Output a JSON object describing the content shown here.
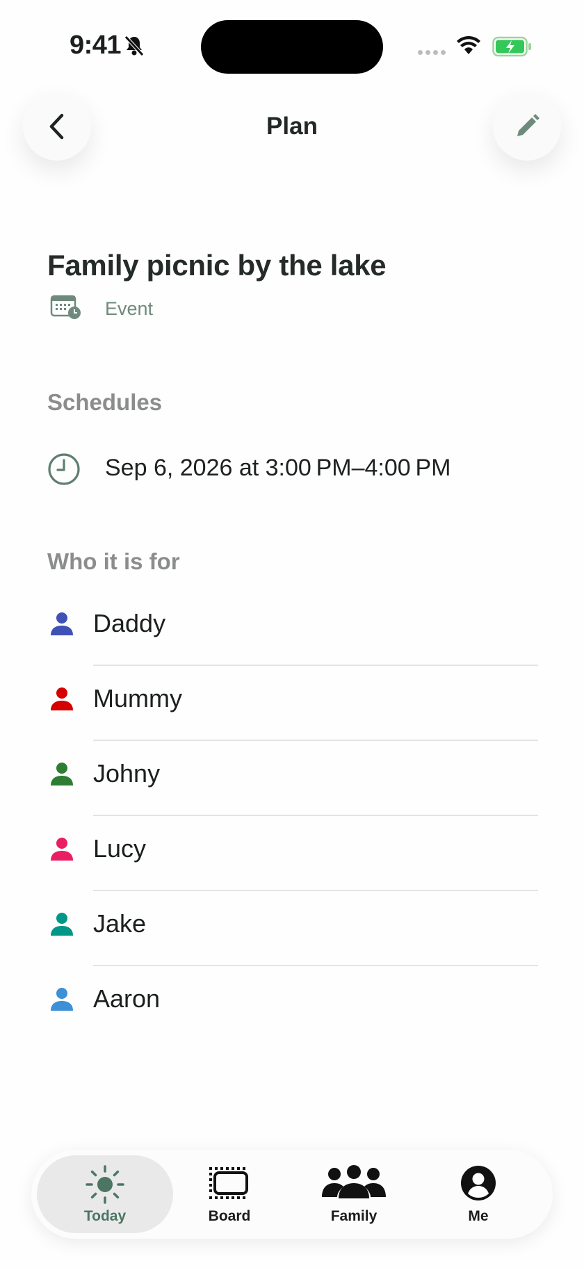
{
  "status": {
    "time": "9:41"
  },
  "header": {
    "title": "Plan"
  },
  "plan": {
    "title": "Family picnic by the lake",
    "type_label": "Event"
  },
  "schedules": {
    "heading": "Schedules",
    "time_range": "Sep 6, 2026 at 3:00 PM–4:00 PM"
  },
  "members": {
    "heading": "Who it is for",
    "people": [
      {
        "name": "Daddy",
        "color": "#3f51b5"
      },
      {
        "name": "Mummy",
        "color": "#d50000"
      },
      {
        "name": "Johny",
        "color": "#2e7d32"
      },
      {
        "name": "Lucy",
        "color": "#e91e63"
      },
      {
        "name": "Jake",
        "color": "#009688"
      },
      {
        "name": "Aaron",
        "color": "#3d8fd6"
      }
    ]
  },
  "tabs": {
    "today": "Today",
    "board": "Board",
    "family": "Family",
    "me": "Me"
  },
  "colors": {
    "accent": "#4c7563",
    "icon_green": "#5e7f70"
  }
}
